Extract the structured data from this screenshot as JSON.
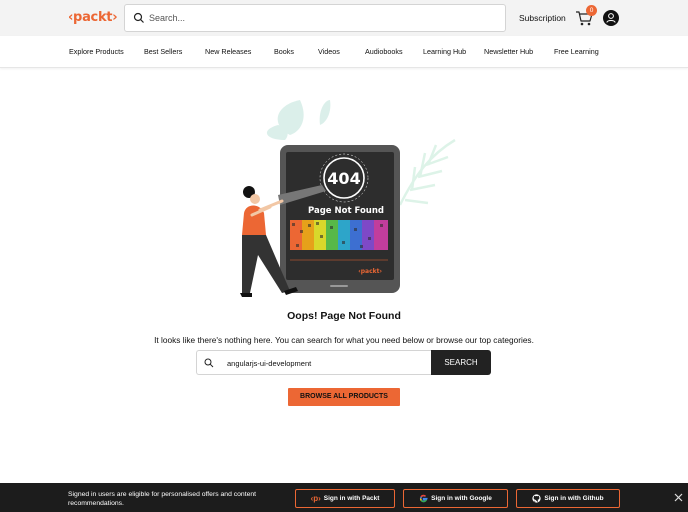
{
  "header": {
    "logo": "‹packt›",
    "search_placeholder": "Search...",
    "subscription": "Subscription",
    "cart_count": "0"
  },
  "nav": {
    "items": [
      "Explore Products",
      "Best Sellers",
      "New Releases",
      "Books",
      "Videos",
      "Audiobooks",
      "Learning Hub",
      "Newsletter Hub",
      "Free Learning"
    ]
  },
  "illustration": {
    "code": "404",
    "caption": "Page Not Found",
    "brand": "‹packt›"
  },
  "main": {
    "title": "Oops! Page Not Found",
    "subtitle": "It looks like there's nothing here. You can search for what you need below or browse our top categories.",
    "search_value": "angularjs-ui-development",
    "search_button": "SEARCH",
    "browse_button": "BROWSE ALL PRODUCTS"
  },
  "footer": {
    "message": "Signed in users are eligible for personalised offers and content recommendations.",
    "packt_prefix": "Sign in with ",
    "packt_name": "Packt",
    "google_prefix": "Sign in with ",
    "google_name": "Google",
    "github_prefix": "Sign in with ",
    "github_name": "Github"
  },
  "colors": {
    "accent": "#ec6734",
    "dark": "#1c1c1c"
  },
  "icons": [
    "search-icon",
    "cart-icon",
    "user-icon",
    "packt-icon",
    "google-icon",
    "github-icon",
    "close-icon"
  ]
}
